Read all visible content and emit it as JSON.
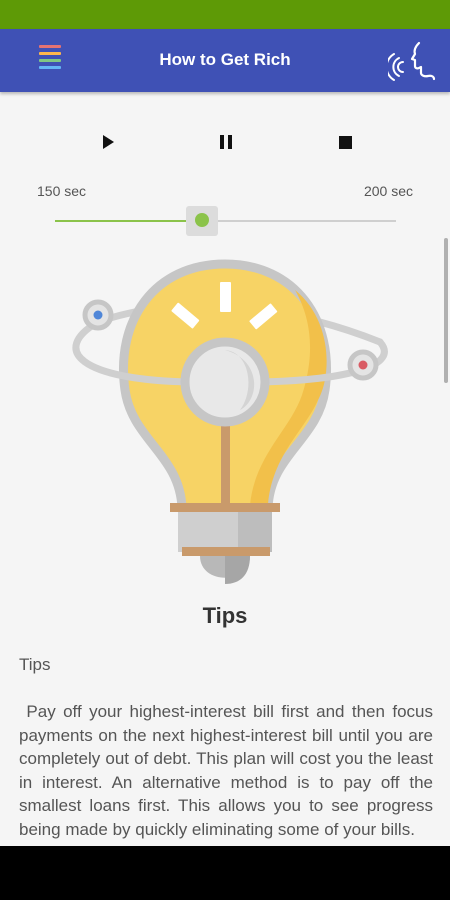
{
  "app_bar": {
    "title": "How to Get Rich",
    "menu_colors": [
      "#e57373",
      "#ffb74d",
      "#81c784",
      "#64b5f6"
    ]
  },
  "player": {
    "speed_min_label": "150 sec",
    "speed_max_label": "200 sec",
    "speed_fraction": 0.43
  },
  "article": {
    "caption": "Tips",
    "heading": "Tips",
    "body": " Pay off your highest-interest bill first and then focus payments on the next highest-interest bill until you are completely out of debt. This plan will cost you the least in interest. An alternative method is to pay off the smallest loans first. This allows you to see progress being made by quickly eliminating some of your bills."
  },
  "colors": {
    "status_bar": "#5e9a06",
    "app_bar": "#3f51b5",
    "accent": "#8bc34a"
  },
  "icons": [
    "menu-icon",
    "voice-icon",
    "play-icon",
    "pause-icon",
    "stop-icon",
    "lightbulb-illustration"
  ]
}
